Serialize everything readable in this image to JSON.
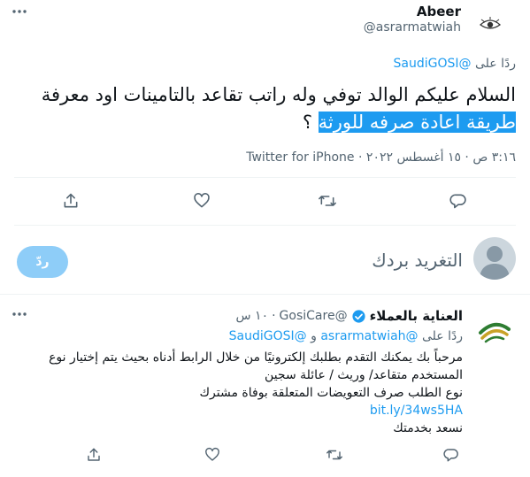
{
  "main_tweet": {
    "display_name": "Abeer",
    "handle": "@asrarmatwiah",
    "more_icon": "more-icon",
    "reply_prefix": "ردًا على",
    "reply_to": "@SaudiGOSI",
    "text_plain": "السلام عليكم الوالد توفي وله راتب تقاعد بالتامينات اود معرفة",
    "text_highlighted": "طريقة اعادة صرفه للورثة",
    "text_end": " ؟",
    "meta": "٣:١٦ ص · ١٥ أغسطس ٢٠٢٢ · Twitter for iPhone",
    "actions": [
      "reply-icon",
      "retweet-icon",
      "like-icon",
      "share-icon"
    ]
  },
  "compose": {
    "placeholder": "التغريد بردك",
    "reply_button": "ردّ"
  },
  "reply_tweet": {
    "display_name": "العناية بالعملاء",
    "verified_icon": "verified-badge-icon",
    "handle": "@GosiCare",
    "time": "١٠ س",
    "reply_prefix": "ردًا على",
    "reply_to_1": "@asrarmatwiah",
    "reply_and": "و",
    "reply_to_2": "@SaudiGOSI",
    "line1": "مرحباً بك يمكنك التقدم بطلبك إلكترونيًا من خلال الرابط أدناه بحيث يتم إختيار نوع",
    "line2": "المستخدم متقاعد/ وريث / عائلة سجين",
    "line3": "نوع الطلب صرف التعويضات المتعلقة بوفاة مشترك",
    "link": "bit.ly/34ws5HA",
    "line4": "نسعد بخدمتك"
  },
  "colors": {
    "accent": "#1d9bf0",
    "highlight": "#1d9bf0",
    "text": "#0f1419",
    "muted": "#536471",
    "divider": "#eff3f4"
  }
}
